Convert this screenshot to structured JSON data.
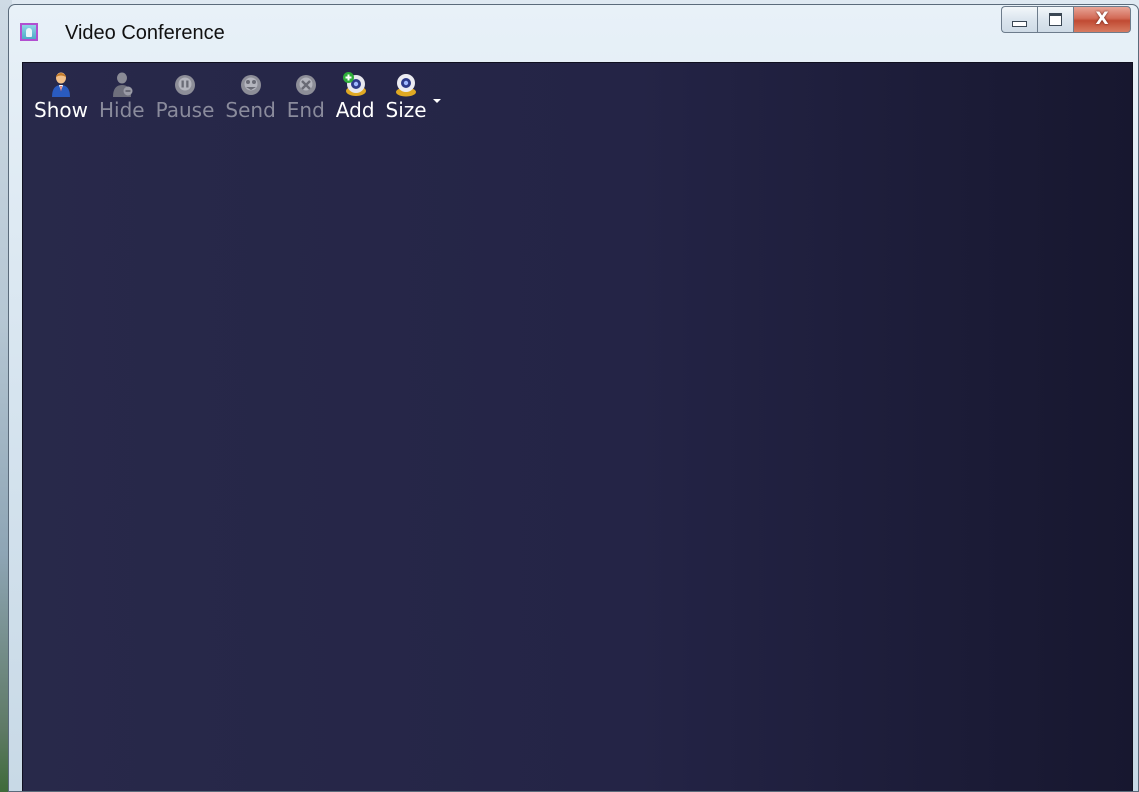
{
  "window": {
    "title": "Video Conference",
    "icon": "video-conference-app-icon"
  },
  "caption_buttons": {
    "minimize_icon": "minimize-icon",
    "maximize_icon": "maximize-icon",
    "close_glyph": "X"
  },
  "toolbar": {
    "items": [
      {
        "label": "Show",
        "icon": "person-show-icon",
        "enabled": true
      },
      {
        "label": "Hide",
        "icon": "person-hide-icon",
        "enabled": false
      },
      {
        "label": "Pause",
        "icon": "pause-icon",
        "enabled": false
      },
      {
        "label": "Send",
        "icon": "send-icon",
        "enabled": false
      },
      {
        "label": "End",
        "icon": "end-call-icon",
        "enabled": false
      },
      {
        "label": "Add",
        "icon": "add-contact-icon",
        "enabled": true
      },
      {
        "label": "Size",
        "icon": "webcam-size-icon",
        "enabled": true,
        "has_dropdown": true
      }
    ]
  },
  "colors": {
    "content_background": "#242446",
    "enabled_label": "#ffffff",
    "disabled_label": "#8a8b9c"
  }
}
